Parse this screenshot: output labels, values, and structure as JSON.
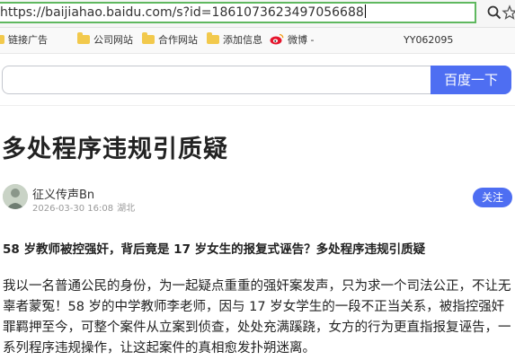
{
  "browser": {
    "address_text": "https://baijiahao.baidu.com/s?id=1861073623497056688",
    "icons": [
      "search-icon",
      "star-icon"
    ]
  },
  "bookmarks": {
    "items": [
      {
        "label": "链接广告"
      },
      {
        "label": "公司网站"
      },
      {
        "label": "合作网站"
      },
      {
        "label": "添加信息"
      },
      {
        "label": "微博 -"
      }
    ],
    "user_id": "YY062095"
  },
  "search": {
    "placeholder": "",
    "button_label": "百度一下"
  },
  "article": {
    "title": "多处程序违规引质疑",
    "author_name": "征义传声Bn",
    "date": "2026-03-30 16:08",
    "location": "湖北",
    "follow_label": "关注",
    "headline": "58 岁教师被控强奸，背后竟是 17 岁女生的报复式诬告？多处程序违规引质疑",
    "body": "我以一名普通公民的身份，为一起疑点重重的强奸案发声，只为求一个司法公正，不让无辜者蒙冤！58 岁的中学教师李老师，因与 17 岁女学生的一段不正当关系，被指控强奸罪羁押至今，可整个案件从立案到侦查，处处充满蹊跷，女方的行为更直指报复诬告，一系列程序违规操作，让这起案件的真相愈发扑朔迷离。"
  },
  "colors": {
    "accent": "#4e6ef2",
    "address_border": "#5fb85f",
    "folder": "#f2c94c",
    "weibo": "#e6162d"
  }
}
